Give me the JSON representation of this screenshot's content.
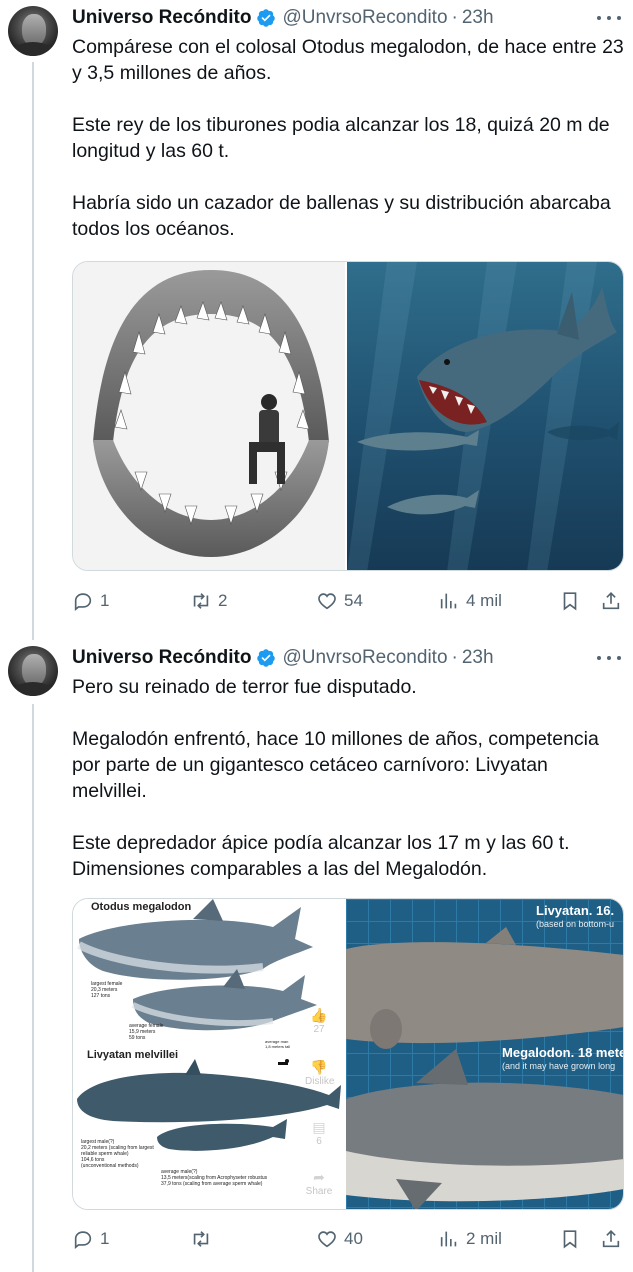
{
  "tweets": [
    {
      "author_name": "Universo Recóndito",
      "handle": "@UnvrsoRecondito",
      "time": "23h",
      "paragraphs": [
        "Compárese con el colosal Otodus megalodon, de hace entre 23 y 3,5 millones de años.",
        "Este rey de los tiburones podia alcanzar los 18, quizá 20 m de longitud y las 60 t.",
        "Habría sido un cazador de ballenas y su distribución abarcaba todos los océanos."
      ],
      "media": [
        {
          "icon": "megalodon-jaws-photo"
        },
        {
          "icon": "megalodon-illustration"
        }
      ],
      "stats": {
        "replies": "1",
        "reposts": "2",
        "likes": "54",
        "views": "4 mil"
      }
    },
    {
      "author_name": "Universo Recóndito",
      "handle": "@UnvrsoRecondito",
      "time": "23h",
      "paragraphs": [
        "Pero su reinado de terror fue disputado.",
        "Megalodón enfrentó, hace 10 millones de años, competencia por parte de un gigantesco cetáceo carnívoro: Livyatan melvillei.",
        "Este depredador ápice podía alcanzar los 17 m y las 60 t. Dimensiones comparables a las del Megalodón."
      ],
      "media_left": {
        "title_top": "Otodus megalodon",
        "female_large": "largest female\n20,3 meters\n127 tons",
        "female_avg": "average female\n15,9 meters\n59 tons",
        "man_label": "average man\n1,8 meters tall",
        "title_bottom": "Livyatan melvillei",
        "male_large": "largest male(?)\n20,2 meters (scaling from largest reliable sperm whale)\n104,6 tons\n(unconventional methods)",
        "male_avg": "average male(?)\n13,5 meters(scaling from Acrophyseter robustus\n37,9 tons (scaling from average sperm whale)",
        "overlay": {
          "likes": "27",
          "dislike": "Dislike",
          "comments": "6",
          "share": "Share"
        }
      },
      "media_right": {
        "label_top": "Livyatan. 16.",
        "label_top_sub": "(based on bottom-u",
        "label_mid": "Megalodon. 18 mete",
        "label_mid_sub": "(and it may have grown long"
      },
      "stats": {
        "replies": "1",
        "reposts": "",
        "likes": "40",
        "views": "2 mil"
      }
    }
  ],
  "colors": {
    "verified": "#1d9bf0",
    "muted": "#536471",
    "text": "#0f1419",
    "line": "#cfd9de"
  }
}
